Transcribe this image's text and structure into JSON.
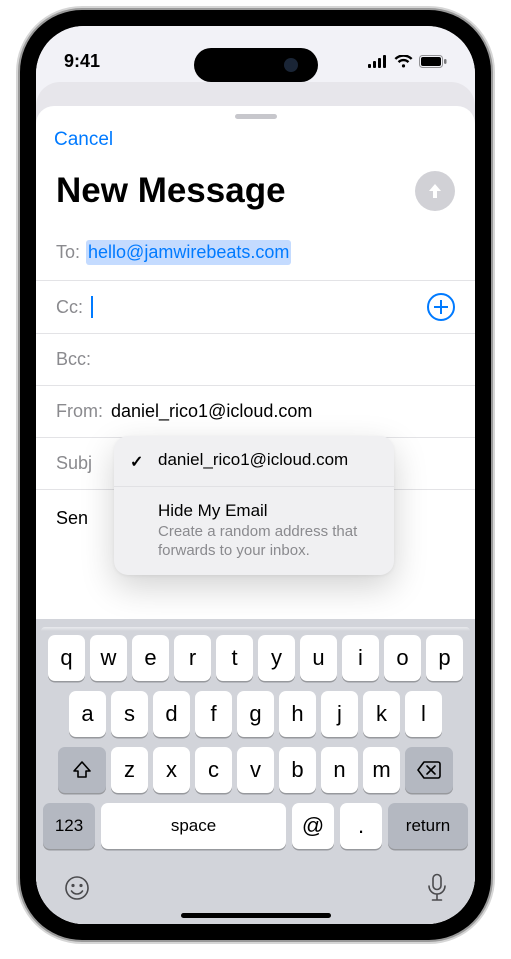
{
  "status": {
    "time": "9:41"
  },
  "nav": {
    "cancel": "Cancel"
  },
  "compose": {
    "title": "New Message",
    "fields": {
      "to_label": "To:",
      "to_value": "hello@jamwirebeats.com",
      "cc_label": "Cc:",
      "bcc_label": "Bcc:",
      "from_label": "From:",
      "from_value": "daniel_rico1@icloud.com",
      "subject_label": "Subj"
    },
    "signature": "Sen"
  },
  "from_menu": {
    "selected": "daniel_rico1@icloud.com",
    "hide_title": "Hide My Email",
    "hide_sub": "Create a random address that forwards to your inbox."
  },
  "keyboard": {
    "row1": [
      "q",
      "w",
      "e",
      "r",
      "t",
      "y",
      "u",
      "i",
      "o",
      "p"
    ],
    "row2": [
      "a",
      "s",
      "d",
      "f",
      "g",
      "h",
      "j",
      "k",
      "l"
    ],
    "row3": [
      "z",
      "x",
      "c",
      "v",
      "b",
      "n",
      "m"
    ],
    "numbers": "123",
    "space": "space",
    "at": "@",
    "dot": ".",
    "return": "return"
  }
}
